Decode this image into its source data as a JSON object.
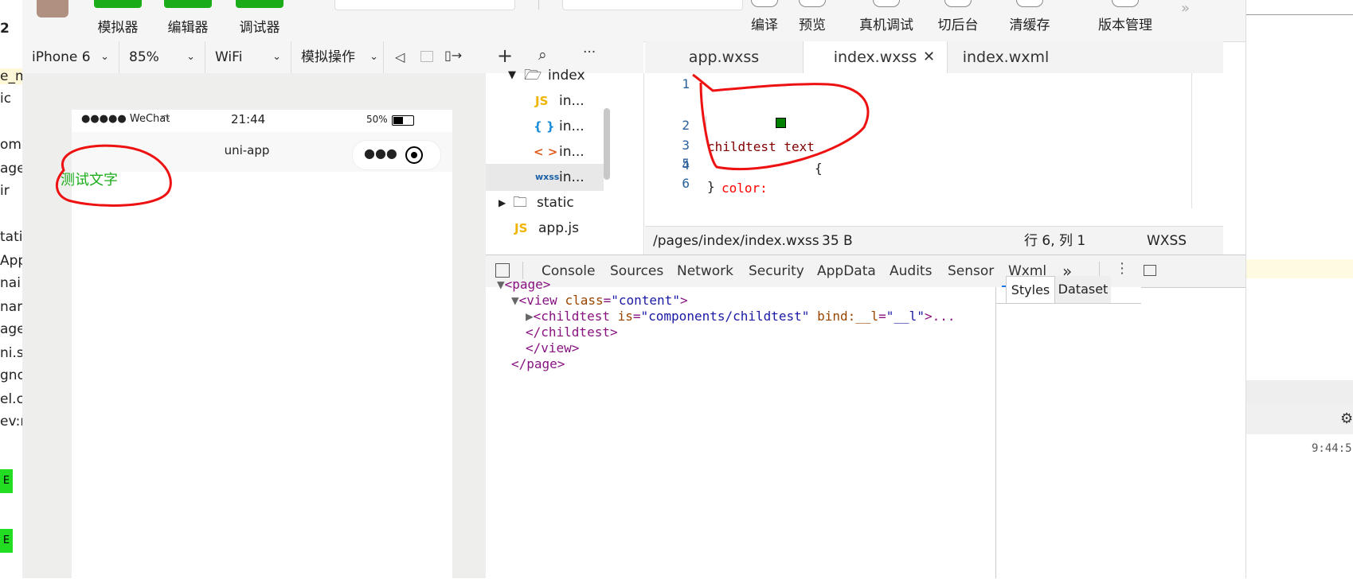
{
  "left_strip": {
    "lines": [
      "2",
      "e_m",
      "ic",
      "om",
      "age",
      "ir",
      "tati",
      "App",
      "nai",
      "nan",
      "age",
      "ni.s",
      "gno",
      "el.c",
      "ev:m"
    ],
    "badges": [
      "E",
      "E"
    ]
  },
  "toolbar": {
    "simulator": "模拟器",
    "editor": "编辑器",
    "debugger": "调试器",
    "compile": "编译",
    "preview": "预览",
    "remote_debug": "真机调试",
    "background": "切后台",
    "clear_cache": "清缓存",
    "version_mgmt": "版本管理"
  },
  "device_bar": {
    "device": "iPhone 6",
    "zoom": "85%",
    "network": "WiFi",
    "simulate_op": "模拟操作"
  },
  "phone": {
    "carrier": "●●●●● WeChat",
    "time": "21:44",
    "battery": "50%",
    "nav_title": "uni-app",
    "content_text": "测试文字",
    "content_color": "#1aad19"
  },
  "file_tree": {
    "items": [
      {
        "icon": "",
        "name": "index"
      },
      {
        "icon": "JS",
        "name": "in..."
      },
      {
        "icon": "{ }",
        "name": "in..."
      },
      {
        "icon": "< >",
        "name": "in..."
      },
      {
        "icon": "wxss",
        "name": "in..."
      },
      {
        "icon": "",
        "name": "static"
      },
      {
        "icon": "JS",
        "name": "app.js"
      }
    ]
  },
  "editor": {
    "tabs": [
      "app.wxss",
      "index.wxss",
      "index.wxml"
    ],
    "line_numbers": [
      "1",
      "2",
      "3",
      "4",
      "5",
      "6"
    ],
    "code": {
      "l2_selector": "childtest text",
      "l2_brace": "{",
      "l3_prop": "color:",
      "l3_value": "green",
      "l3_semi": ";",
      "l4": "}"
    },
    "swatch_color": "#008000",
    "status_path": "/pages/index/index.wxss",
    "status_size": "35 B",
    "status_pos": "行 6, 列 1",
    "status_lang": "WXSS"
  },
  "devtools": {
    "tabs": [
      "Console",
      "Sources",
      "Network",
      "Security",
      "AppData",
      "Audits",
      "Sensor",
      "Wxml"
    ],
    "more": "»",
    "dom": {
      "page_open": "<page>",
      "view_tag": "<view ",
      "view_attr": "class",
      "view_val": "\"content\"",
      "view_close": ">",
      "child_tag": "<childtest ",
      "child_attr1": "is",
      "child_val1": "\"components/childtest\"",
      "child_attr2": "bind:__l",
      "child_val2": "\"__l\"",
      "child_close": ">...",
      "child_end": "</childtest>",
      "view_end": "</view>",
      "page_end": "</page>"
    },
    "side_tabs": [
      "Styles",
      "Dataset"
    ]
  },
  "right_bg": {
    "timestamp": "9:44:5"
  }
}
